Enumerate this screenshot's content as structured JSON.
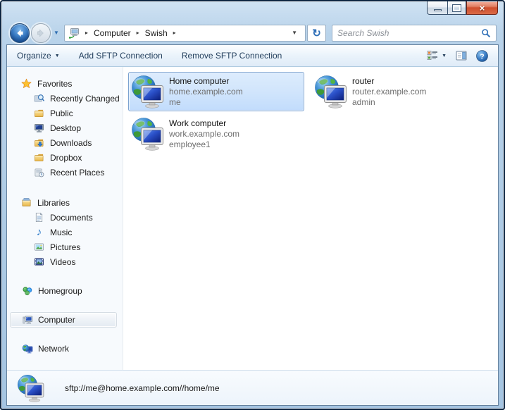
{
  "titlebar": {
    "controls": [
      "minimize",
      "maximize",
      "close"
    ]
  },
  "navbar": {
    "breadcrumb": {
      "items": [
        {
          "label": "Computer"
        },
        {
          "label": "Swish"
        }
      ]
    },
    "search": {
      "placeholder": "Search Swish",
      "value": ""
    }
  },
  "toolbar": {
    "organize_label": "Organize",
    "add_label": "Add SFTP Connection",
    "remove_label": "Remove SFTP Connection"
  },
  "sidebar": {
    "groups": [
      {
        "label": "Favorites",
        "icon": "star-icon",
        "items": [
          {
            "label": "Recently Changed",
            "icon": "search-folder-icon"
          },
          {
            "label": "Public",
            "icon": "folder-icon"
          },
          {
            "label": "Desktop",
            "icon": "desktop-icon"
          },
          {
            "label": "Downloads",
            "icon": "downloads-folder-icon"
          },
          {
            "label": "Dropbox",
            "icon": "folder-icon"
          },
          {
            "label": "Recent Places",
            "icon": "recent-places-icon"
          }
        ]
      },
      {
        "label": "Libraries",
        "icon": "libraries-icon",
        "items": [
          {
            "label": "Documents",
            "icon": "document-icon"
          },
          {
            "label": "Music",
            "icon": "music-note-icon"
          },
          {
            "label": "Pictures",
            "icon": "picture-icon"
          },
          {
            "label": "Videos",
            "icon": "film-icon"
          }
        ]
      }
    ],
    "singles": [
      {
        "label": "Homegroup",
        "icon": "homegroup-icon",
        "selected": false
      },
      {
        "label": "Computer",
        "icon": "computer-icon",
        "selected": true
      },
      {
        "label": "Network",
        "icon": "network-icon",
        "selected": false
      }
    ]
  },
  "main": {
    "tiles": [
      {
        "name": "Home computer",
        "host": "home.example.com",
        "user": "me",
        "selected": true
      },
      {
        "name": "router",
        "host": "router.example.com",
        "user": "admin",
        "selected": false
      },
      {
        "name": "Work computer",
        "host": "work.example.com",
        "user": "employee1",
        "selected": false
      }
    ]
  },
  "statusbar": {
    "text": "sftp://me@home.example.com//home/me"
  },
  "glyphs": {
    "breadcrumb_separator": "▸",
    "dropdown": "▼",
    "refresh": "↻",
    "help": "?",
    "close": "×",
    "music": "♪"
  },
  "colors": {
    "selection_border": "#7ba2d0",
    "selection_fill": "#cfe3fc",
    "glass_frame": "#aecbe5",
    "toolbar_text": "#24405e",
    "accent_blue": "#2f6fb7"
  }
}
